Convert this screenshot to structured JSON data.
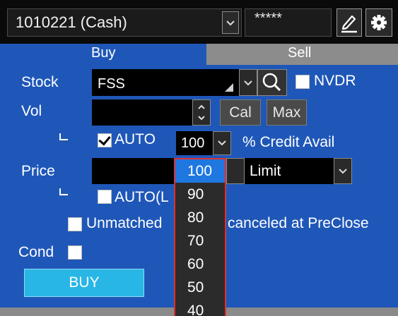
{
  "account": {
    "selected": "1010221 (Cash)",
    "pin_mask": "*****"
  },
  "tabs": {
    "buy": "Buy",
    "sell": "Sell"
  },
  "form": {
    "stock_label": "Stock",
    "stock_value": "FSS",
    "nvdr_label": "NVDR",
    "vol_label": "Vol",
    "cal_label": "Cal",
    "max_label": "Max",
    "auto_label": "AUTO",
    "auto_checked": true,
    "percent_value": "100",
    "credit_label": "% Credit Avail",
    "price_label": "Price",
    "order_type": "Limit",
    "auto_l_label": "AUTO(L",
    "unmatched_label_left": "Unmatched",
    "unmatched_label_right": "canceled at PreClose",
    "cond_label": "Cond",
    "buy_button": "BUY"
  },
  "percent_options": [
    "100",
    "90",
    "80",
    "70",
    "60",
    "50",
    "40"
  ],
  "percent_selected_index": 0,
  "colors": {
    "panel": "#1f57b8",
    "buy_button": "#28b6e6",
    "highlight": "#1f77e0",
    "dropdown_border": "#e03030"
  }
}
